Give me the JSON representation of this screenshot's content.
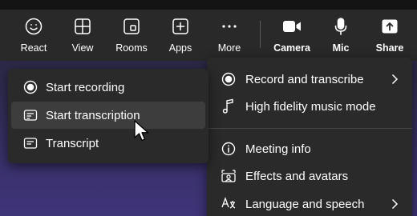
{
  "toolbar": {
    "items": [
      {
        "label": "React",
        "icon": "smiley-icon"
      },
      {
        "label": "View",
        "icon": "grid-view-icon"
      },
      {
        "label": "Rooms",
        "icon": "rooms-icon"
      },
      {
        "label": "Apps",
        "icon": "plus-square-icon"
      },
      {
        "label": "More",
        "icon": "ellipsis-icon",
        "active": true
      },
      {
        "label": "Camera",
        "icon": "camera-icon"
      },
      {
        "label": "Mic",
        "icon": "microphone-icon"
      },
      {
        "label": "Share",
        "icon": "share-arrow-icon"
      }
    ],
    "accent_color": "#7f85f5"
  },
  "more_menu": {
    "items": [
      {
        "label": "Record and transcribe",
        "icon": "record-icon",
        "has_submenu": true
      },
      {
        "label": "High fidelity music mode",
        "icon": "music-note-icon"
      },
      {
        "label": "Meeting info",
        "icon": "info-icon"
      },
      {
        "label": "Effects and avatars",
        "icon": "effects-icon"
      },
      {
        "label": "Language and speech",
        "icon": "language-icon",
        "has_submenu": true
      }
    ]
  },
  "record_submenu": {
    "items": [
      {
        "label": "Start recording",
        "icon": "record-icon"
      },
      {
        "label": "Start transcription",
        "icon": "transcription-icon",
        "hovered": true
      },
      {
        "label": "Transcript",
        "icon": "transcript-icon"
      }
    ]
  }
}
